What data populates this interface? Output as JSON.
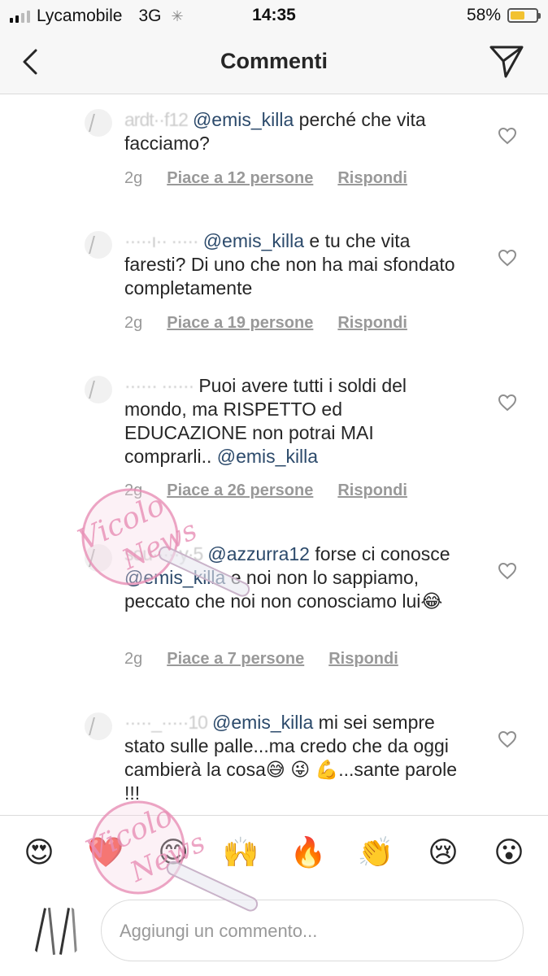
{
  "status_bar": {
    "carrier": "Lycamobile",
    "network": "3G",
    "time": "14:35",
    "battery": "58%",
    "battery_level": 0.58
  },
  "header": {
    "title": "Commenti",
    "back_icon": "chevron-left-icon",
    "send_icon": "paper-plane-icon"
  },
  "comments": [
    {
      "username": "ardt··f12",
      "parts": [
        {
          "type": "mention",
          "text": "@emis_killa"
        },
        {
          "type": "text",
          "text": " perché che vita facciamo?"
        }
      ],
      "time": "2g",
      "likes": "Piace a 12 persone",
      "reply": "Rispondi"
    },
    {
      "username": "·····ı·· ·····",
      "parts": [
        {
          "type": "mention",
          "text": "@emis_killa"
        },
        {
          "type": "text",
          "text": " e tu che vita faresti? Di uno che non ha mai sfondato completamente"
        }
      ],
      "time": "2g",
      "likes": "Piace a 19 persone",
      "reply": "Rispondi"
    },
    {
      "username": "······ ······",
      "parts": [
        {
          "type": "text",
          "text": "Puoi avere tutti i soldi del mondo, ma RISPETTO ed EDUCAZIONE non potrai MAI comprarli.. "
        },
        {
          "type": "mention",
          "text": "@emis_killa"
        }
      ],
      "time": "2g",
      "likes": "Piace a 26 persone",
      "reply": "Rispondi"
    },
    {
      "username": "sou·····y·5",
      "parts": [
        {
          "type": "mention",
          "text": "@azzurra12"
        },
        {
          "type": "text",
          "text": " forse ci conosce "
        },
        {
          "type": "mention",
          "text": "@emis_killa"
        },
        {
          "type": "text",
          "text": " e noi non lo sappiamo, peccato che noi non conosciamo lui😂"
        }
      ],
      "time": "2g",
      "likes": "Piace a 7 persone",
      "reply": "Rispondi"
    },
    {
      "username": "·····_·····10",
      "parts": [
        {
          "type": "mention",
          "text": "@emis_killa"
        },
        {
          "type": "text",
          "text": "  mi sei sempre stato sulle palle...ma credo che da oggi cambierà la cosa😅 😜 💪...sante parole !!!"
        }
      ]
    }
  ],
  "emoji_bar": [
    "😍",
    "❤️",
    "😊",
    "🙌",
    "🔥",
    "👏",
    "😢",
    "😮"
  ],
  "composer": {
    "placeholder": "Aggiungi un commento..."
  },
  "watermark": {
    "text": "Vicolo delle News"
  }
}
